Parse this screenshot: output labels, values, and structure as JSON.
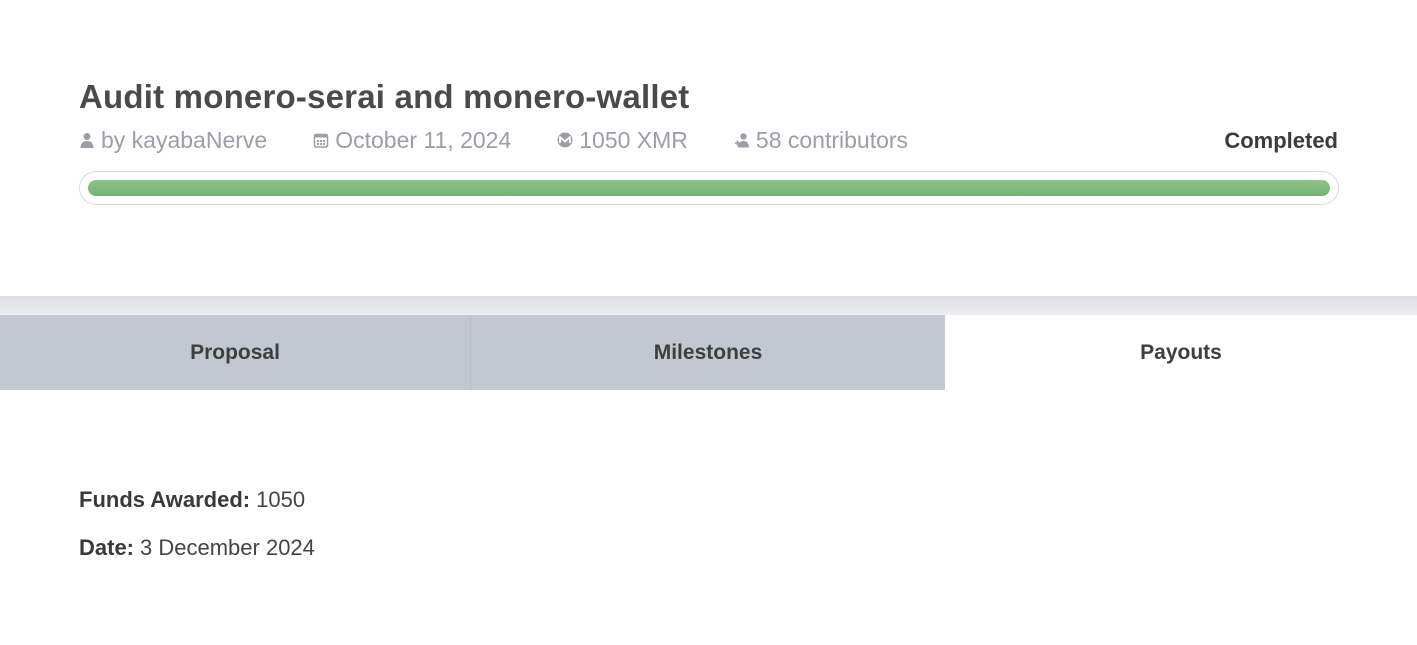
{
  "proposal": {
    "title": "Audit monero-serai and monero-wallet",
    "author": "by kayabaNerve",
    "date": "October 11, 2024",
    "amount": "1050 XMR",
    "contributors": "58 contributors",
    "status": "Completed",
    "progress_percent": 100,
    "progress_color": "#7db87d"
  },
  "icons": {
    "author": "user-icon",
    "date": "calendar-icon",
    "amount": "monero-icon",
    "contributors": "users-icon"
  },
  "tabs": [
    {
      "label": "Proposal",
      "active": false
    },
    {
      "label": "Milestones",
      "active": false
    },
    {
      "label": "Payouts",
      "active": true
    }
  ],
  "payout": {
    "funds_label": "Funds Awarded:",
    "funds_value": "1050",
    "date_label": "Date:",
    "date_value": "3 December 2024"
  }
}
